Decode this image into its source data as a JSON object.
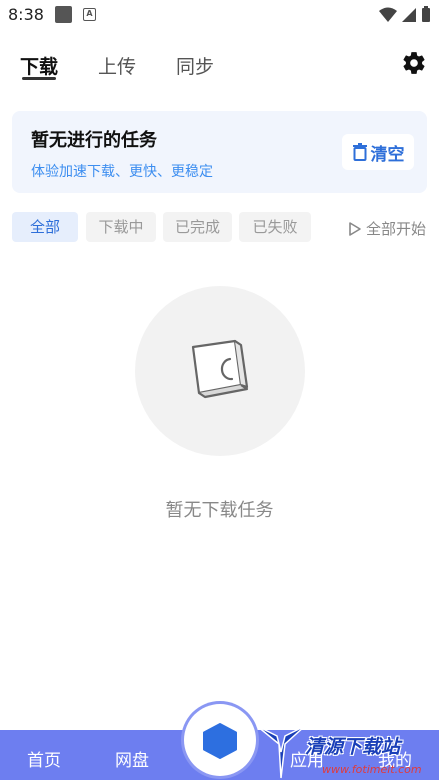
{
  "status_bar": {
    "time": "8:38",
    "icons": [
      "notification-square-icon",
      "a-app-icon",
      "wifi-icon",
      "signal-icon",
      "battery-icon"
    ]
  },
  "top_tabs": [
    {
      "label": "下载",
      "active": true
    },
    {
      "label": "上传",
      "active": false
    },
    {
      "label": "同步",
      "active": false
    }
  ],
  "settings_icon": "gear-icon",
  "banner": {
    "title": "暂无进行的任务",
    "subtitle": "体验加速下载、更快、更稳定",
    "clear_label": "清空",
    "clear_icon": "trash-icon"
  },
  "filters": [
    {
      "label": "全部",
      "active": true
    },
    {
      "label": "下载中",
      "active": false
    },
    {
      "label": "已完成",
      "active": false
    },
    {
      "label": "已失败",
      "active": false
    }
  ],
  "start_all": {
    "label": "全部开始",
    "icon": "play-outline-icon"
  },
  "empty_state": {
    "text": "暂无下载任务",
    "icon": "empty-box-icon"
  },
  "bottom_nav": {
    "items": [
      "首页",
      "网盘",
      "应用",
      "我的"
    ],
    "center_icon": "hexagon-icon"
  },
  "watermark": {
    "text": "清源下载站",
    "url": "www.fotimeit.com"
  },
  "colors": {
    "accent": "#2e6fd9",
    "banner_bg": "#f1f5fd",
    "subtitle": "#3d8ef0",
    "bottom_nav": "#6d7ef0",
    "hexagon": "#2d6fe0"
  }
}
